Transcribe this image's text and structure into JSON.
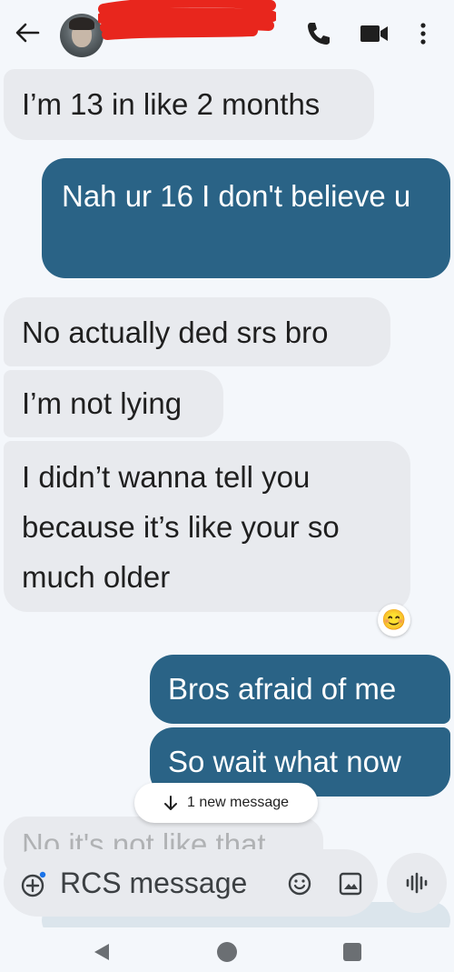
{
  "header": {
    "icons": [
      "back-arrow-icon",
      "avatar",
      "phone-icon",
      "video-camera-icon",
      "more-vertical-icon"
    ]
  },
  "messages": [
    {
      "direction": "incoming",
      "text": "I’m 13 in like 2 months"
    },
    {
      "direction": "outgoing",
      "text": "Nah ur 16 I don't believe u"
    },
    {
      "direction": "incoming",
      "text": "No actually ded srs bro"
    },
    {
      "direction": "incoming",
      "text": "I’m not lying"
    },
    {
      "direction": "incoming",
      "text": "I didn’t wanna tell you because it’s like your so much older"
    },
    {
      "direction": "outgoing",
      "text": "Bros afraid of me"
    },
    {
      "direction": "outgoing",
      "text": "So wait what now"
    },
    {
      "direction": "incoming",
      "text": "No it's not like that"
    }
  ],
  "reaction": {
    "emoji": "😊"
  },
  "new_message_pill": {
    "label": "1 new message"
  },
  "compose": {
    "placeholder": "RCS message"
  },
  "colors": {
    "outgoing_bubble": "#2a6386",
    "incoming_bubble": "#e8eaee",
    "background": "#f4f7fb",
    "redaction": "#e8261d"
  }
}
